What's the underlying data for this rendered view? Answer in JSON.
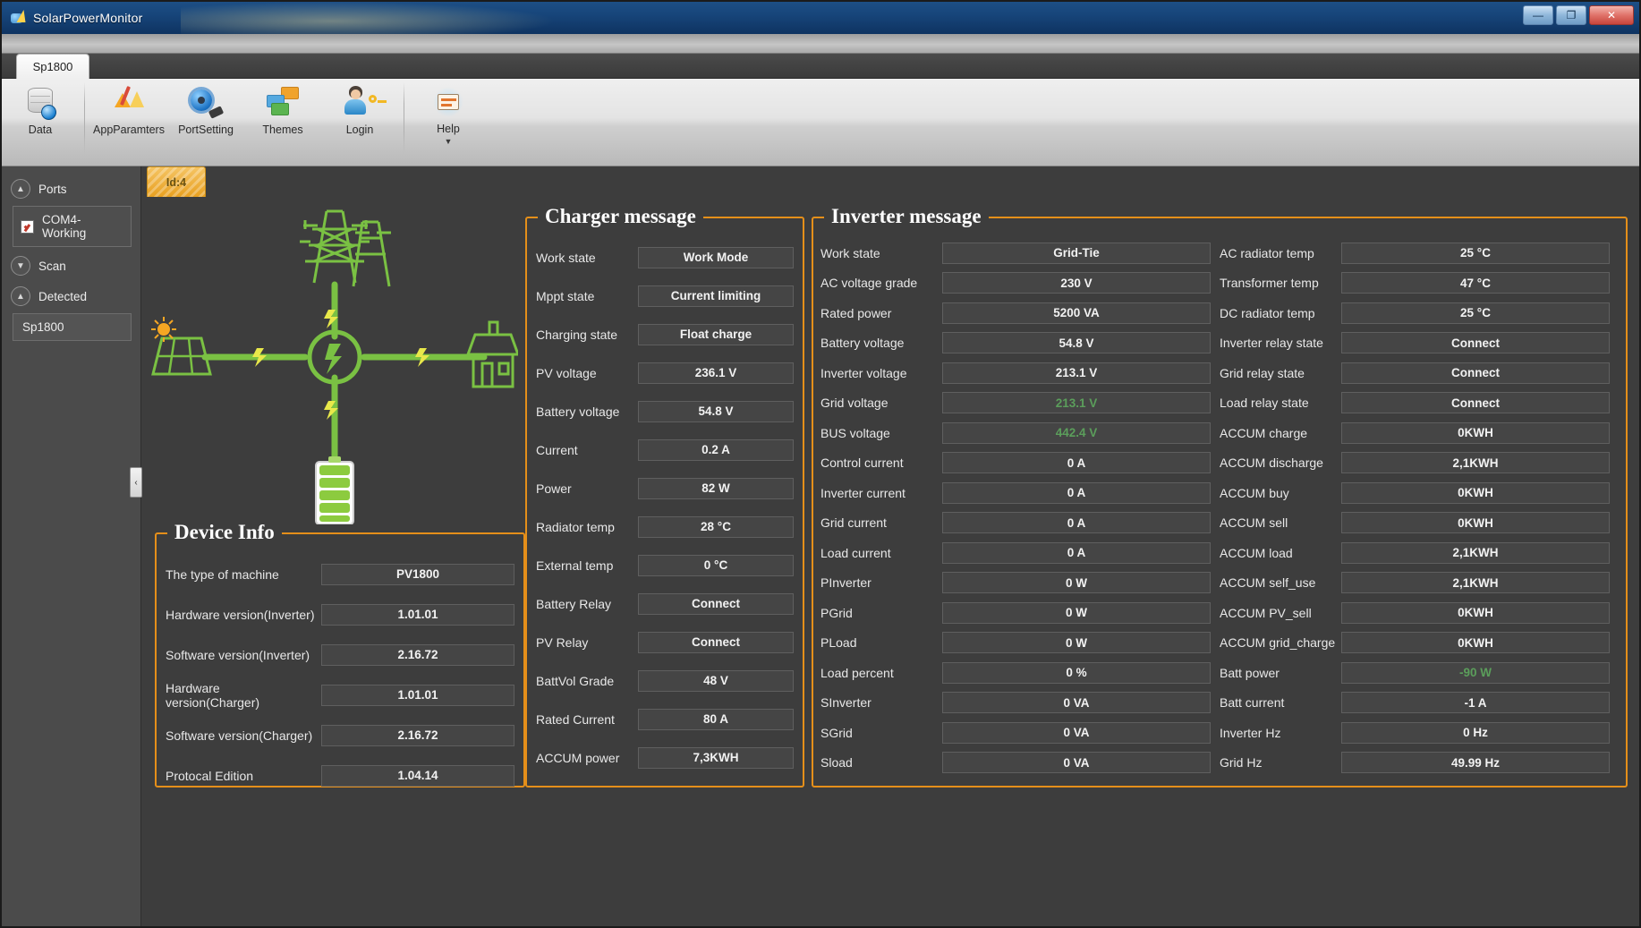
{
  "window": {
    "title": "SolarPowerMonitor",
    "minimize_label": "—",
    "maximize_label": "❐",
    "close_label": "✕"
  },
  "tabbar": {
    "tab_label": "Sp1800"
  },
  "ribbon": {
    "buttons": [
      {
        "label": "Data",
        "icon": "database-icon"
      },
      {
        "label": "AppParamters",
        "icon": "parameters-icon"
      },
      {
        "label": "PortSetting",
        "icon": "port-setting-icon"
      },
      {
        "label": "Themes",
        "icon": "themes-icon"
      },
      {
        "label": "Login",
        "icon": "login-icon"
      },
      {
        "label": "Help",
        "icon": "help-icon",
        "caret": "▼"
      }
    ]
  },
  "sidebar": {
    "ports_label": "Ports",
    "ports_chevron": "▲",
    "com_port": {
      "label": "COM4-Working",
      "checked": true
    },
    "scan_label": "Scan",
    "scan_chevron": "▼",
    "detected_label": "Detected",
    "detected_chevron": "▲",
    "detected_item": "Sp1800",
    "collapse_handle": "‹"
  },
  "content": {
    "id_tab": "Id:4"
  },
  "charger": {
    "title": "Charger message",
    "rows": [
      {
        "label": "Work state",
        "value": "Work Mode"
      },
      {
        "label": "Mppt state",
        "value": "Current limiting"
      },
      {
        "label": "Charging state",
        "value": "Float charge"
      },
      {
        "label": "PV voltage",
        "value": "236.1 V"
      },
      {
        "label": "Battery voltage",
        "value": "54.8 V"
      },
      {
        "label": "Current",
        "value": "0.2 A"
      },
      {
        "label": "Power",
        "value": "82 W"
      },
      {
        "label": "Radiator temp",
        "value": "28 °C"
      },
      {
        "label": "External temp",
        "value": "0 °C"
      },
      {
        "label": "Battery Relay",
        "value": "Connect"
      },
      {
        "label": "PV Relay",
        "value": "Connect"
      },
      {
        "label": "BattVol Grade",
        "value": "48 V"
      },
      {
        "label": "Rated Current",
        "value": "80 A"
      },
      {
        "label": "ACCUM power",
        "value": "7,3KWH"
      }
    ]
  },
  "device_info": {
    "title": "Device Info",
    "rows": [
      {
        "label": "The type of machine",
        "value": "PV1800"
      },
      {
        "label": "Hardware version(Inverter)",
        "value": "1.01.01"
      },
      {
        "label": "Software version(Inverter)",
        "value": "2.16.72"
      },
      {
        "label": "Hardware version(Charger)",
        "value": "1.01.01"
      },
      {
        "label": "Software version(Charger)",
        "value": "2.16.72"
      },
      {
        "label": "Protocal Edition",
        "value": "1.04.14"
      }
    ]
  },
  "inverter": {
    "title": "Inverter message",
    "left_rows": [
      {
        "label": "Work state",
        "value": "Grid-Tie",
        "color": "normal"
      },
      {
        "label": "AC voltage grade",
        "value": "230 V",
        "color": "normal"
      },
      {
        "label": "Rated power",
        "value": "5200 VA",
        "color": "normal"
      },
      {
        "label": "Battery voltage",
        "value": "54.8 V",
        "color": "normal"
      },
      {
        "label": "Inverter voltage",
        "value": "213.1 V",
        "color": "normal"
      },
      {
        "label": "Grid voltage",
        "value": "213.1 V",
        "color": "green"
      },
      {
        "label": "BUS voltage",
        "value": "442.4 V",
        "color": "green"
      },
      {
        "label": "Control current",
        "value": "0 A",
        "color": "normal"
      },
      {
        "label": "Inverter current",
        "value": "0 A",
        "color": "normal"
      },
      {
        "label": "Grid current",
        "value": "0 A",
        "color": "normal"
      },
      {
        "label": "Load current",
        "value": "0 A",
        "color": "normal"
      },
      {
        "label": "PInverter",
        "value": "0 W",
        "color": "normal"
      },
      {
        "label": "PGrid",
        "value": "0 W",
        "color": "normal"
      },
      {
        "label": "PLoad",
        "value": "0 W",
        "color": "normal"
      },
      {
        "label": "Load percent",
        "value": "0 %",
        "color": "normal"
      },
      {
        "label": "SInverter",
        "value": "0 VA",
        "color": "normal"
      },
      {
        "label": "SGrid",
        "value": "0 VA",
        "color": "normal"
      },
      {
        "label": "Sload",
        "value": "0 VA",
        "color": "normal"
      }
    ],
    "right_rows": [
      {
        "label": "AC radiator temp",
        "value": "25 °C",
        "color": "normal"
      },
      {
        "label": "Transformer temp",
        "value": "47 °C",
        "color": "normal"
      },
      {
        "label": "DC radiator temp",
        "value": "25 °C",
        "color": "normal"
      },
      {
        "label": "Inverter relay state",
        "value": "Connect",
        "color": "normal"
      },
      {
        "label": "Grid relay state",
        "value": "Connect",
        "color": "normal"
      },
      {
        "label": "Load relay state",
        "value": "Connect",
        "color": "normal"
      },
      {
        "label": "ACCUM charge",
        "value": "0KWH",
        "color": "normal"
      },
      {
        "label": "ACCUM discharge",
        "value": "2,1KWH",
        "color": "normal"
      },
      {
        "label": "ACCUM buy",
        "value": "0KWH",
        "color": "normal"
      },
      {
        "label": "ACCUM sell",
        "value": "0KWH",
        "color": "normal"
      },
      {
        "label": "ACCUM load",
        "value": "2,1KWH",
        "color": "normal"
      },
      {
        "label": "ACCUM self_use",
        "value": "2,1KWH",
        "color": "normal"
      },
      {
        "label": "ACCUM PV_sell",
        "value": "0KWH",
        "color": "normal"
      },
      {
        "label": "ACCUM grid_charge",
        "value": "0KWH",
        "color": "normal"
      },
      {
        "label": "Batt power",
        "value": "-90 W",
        "color": "green"
      },
      {
        "label": "Batt current",
        "value": "-1 A",
        "color": "normal"
      },
      {
        "label": "Inverter Hz",
        "value": "0 Hz",
        "color": "normal"
      },
      {
        "label": "Grid Hz",
        "value": "49.99 Hz",
        "color": "normal"
      }
    ]
  },
  "diagram": {
    "nodes": [
      "pylon-icon",
      "solar-panel-icon",
      "house-icon",
      "battery-icon",
      "inverter-hub-icon"
    ],
    "accent": "#7ac143"
  },
  "colors": {
    "accent_orange": "#e58f1a",
    "panel_bg": "#3d3d3d",
    "field_bg": "#454545",
    "green_text": "#5b9e5b",
    "title_blue": "#17457a"
  }
}
